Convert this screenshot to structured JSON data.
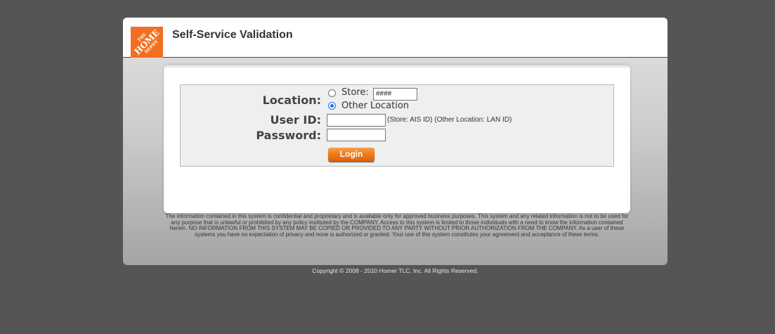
{
  "header": {
    "logo_line1": "THE",
    "logo_line2": "HOME",
    "logo_line3": "DEPOT",
    "title": "Self-Service Validation"
  },
  "form": {
    "location_label": "Location:",
    "store_option": "Store:",
    "store_value": "####",
    "other_option": "Other Location",
    "selected_option": "Other Location",
    "userid_label": "User ID:",
    "userid_value": "",
    "userid_hint": "(Store: AIS ID) (Other Location: LAN ID)",
    "password_label": "Password:",
    "password_value": "",
    "login_label": "Login"
  },
  "disclaimer": "The information contained in this system is confidential and proprietary and is available only for approved business purposes. This system and any related information is not to be used for any purpose that is unlawful or prohibited by any policy instituted by the COMPANY. Access to this system is limited to those individuals with a need to know the information contained herein. NO INFORMATION FROM THIS SYSTEM MAY BE COPIED OR PROVIDED TO ANY PARTY WITHOUT PRIOR AUTHORIZATION FROM THE COMPANY. As a user of these systems you have no expectation of privacy and none is authorized or granted. Your use of this system constitutes your agreement and acceptance of these terms.",
  "footer": {
    "copyright": "Copyright © 2008 - 2010 Homer TLC, Inc. All Rights Reserved."
  },
  "colors": {
    "brand_orange": "#f26f21",
    "page_background": "#555555",
    "radio_selected": "#1a73e8"
  }
}
